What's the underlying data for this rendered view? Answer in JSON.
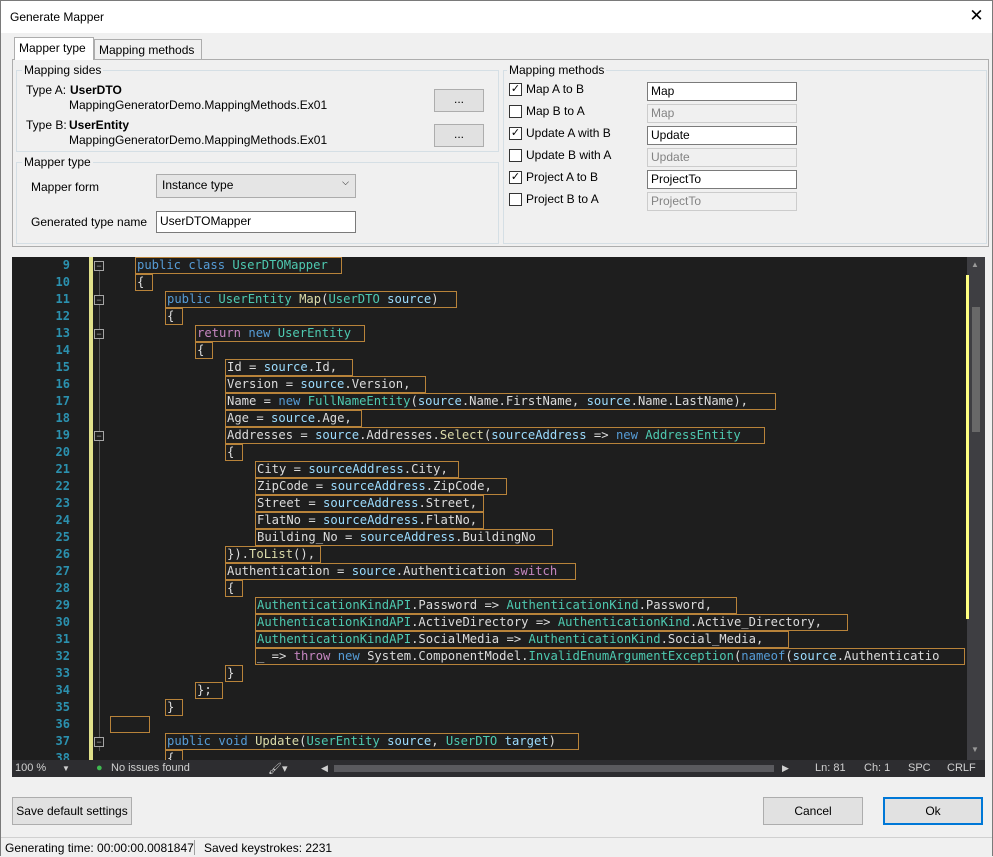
{
  "window": {
    "title": "Generate Mapper",
    "close_glyph": "✕"
  },
  "tabs": [
    {
      "label": "Mapper type"
    },
    {
      "label": "Mapping methods"
    }
  ],
  "mapping_sides": {
    "title": "Mapping sides",
    "type_a": {
      "label": "Type A:",
      "name": "UserDTO",
      "namespace": "MappingGeneratorDemo.MappingMethods.Ex01",
      "browse": "..."
    },
    "type_b": {
      "label": "Type B:",
      "name": "UserEntity",
      "namespace": "MappingGeneratorDemo.MappingMethods.Ex01",
      "browse": "..."
    }
  },
  "mapper_type": {
    "title": "Mapper type",
    "form_label": "Mapper form",
    "form_value": "Instance type",
    "name_label": "Generated type name",
    "name_value": "UserDTOMapper"
  },
  "mapping_methods": {
    "title": "Mapping methods",
    "items": [
      {
        "label": "Map A to B",
        "checked": true,
        "value": "Map",
        "enabled": true
      },
      {
        "label": "Map B to A",
        "checked": false,
        "value": "Map",
        "enabled": false
      },
      {
        "label": "Update A with B",
        "checked": true,
        "value": "Update",
        "enabled": true
      },
      {
        "label": "Update B with A",
        "checked": false,
        "value": "Update",
        "enabled": false
      },
      {
        "label": "Project A to B",
        "checked": true,
        "value": "ProjectTo",
        "enabled": true
      },
      {
        "label": "Project B to A",
        "checked": false,
        "value": "ProjectTo",
        "enabled": false
      }
    ]
  },
  "editor": {
    "line_numbers": [
      "9",
      "10",
      "11",
      "12",
      "13",
      "14",
      "15",
      "16",
      "17",
      "18",
      "19",
      "20",
      "21",
      "22",
      "23",
      "24",
      "25",
      "26",
      "27",
      "28",
      "29",
      "30",
      "31",
      "32",
      "33",
      "34",
      "35",
      "36",
      "37",
      "38"
    ],
    "status": {
      "zoom": "100 %",
      "issues": "No issues found",
      "ln": "Ln: 81",
      "ch": "Ch: 1",
      "spc": "SPC",
      "crlf": "CRLF"
    }
  },
  "footer": {
    "save_defaults": "Save default settings",
    "cancel": "Cancel",
    "ok": "Ok",
    "generating_time": "Generating time:  00:00:00.0081847",
    "saved_keystrokes": "Saved keystrokes:  2231"
  },
  "colors": {
    "editor_bg": "#1e1e1e",
    "keyword": "#569cd6",
    "type": "#4ec9b0",
    "highlight_border": "#b8833a"
  }
}
